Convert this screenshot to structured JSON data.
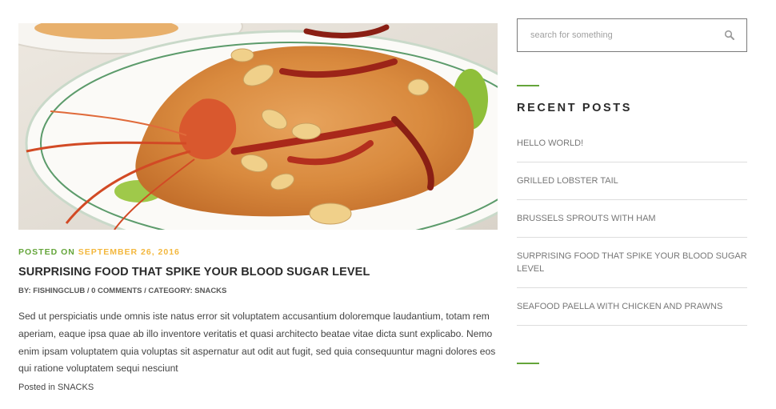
{
  "post": {
    "hero_alt": "Deep fried shrimp with crispy topping, cashew nuts and chili",
    "posted_on_label": "POSTED ON",
    "date": "SEPTEMBER 26, 2016",
    "title": "SURPRISING FOOD THAT SPIKE YOUR BLOOD SUGAR LEVEL",
    "byline": "BY: FISHINGCLUB / 0 COMMENTS / CATEGORY: SNACKS",
    "excerpt": "Sed ut perspiciatis unde omnis iste natus error sit voluptatem accusantium doloremque laudantium, totam rem aperiam, eaque ipsa quae ab illo inventore veritatis et quasi architecto beatae vitae dicta sunt explicabo. Nemo enim ipsam voluptatem quia voluptas sit aspernatur aut odit aut fugit, sed quia consequuntur magni dolores eos qui ratione voluptatem sequi nesciunt",
    "posted_in_label": "Posted in",
    "category": "SNACKS"
  },
  "sidebar": {
    "search": {
      "placeholder": "search for something",
      "value": "",
      "icon": "search-icon"
    },
    "recent_title": "RECENT POSTS",
    "recent_posts": [
      "HELLO WORLD!",
      "GRILLED LOBSTER TAIL",
      "BRUSSELS SPROUTS WITH HAM",
      "SURPRISING FOOD THAT SPIKE YOUR BLOOD SUGAR LEVEL",
      "SEAFOOD PAELLA WITH CHICKEN AND PRAWNS"
    ]
  },
  "colors": {
    "accent_green": "#64a53a",
    "date_yellow": "#f3b73d",
    "title_dark": "#2b2b2b",
    "muted_text": "#777777"
  }
}
